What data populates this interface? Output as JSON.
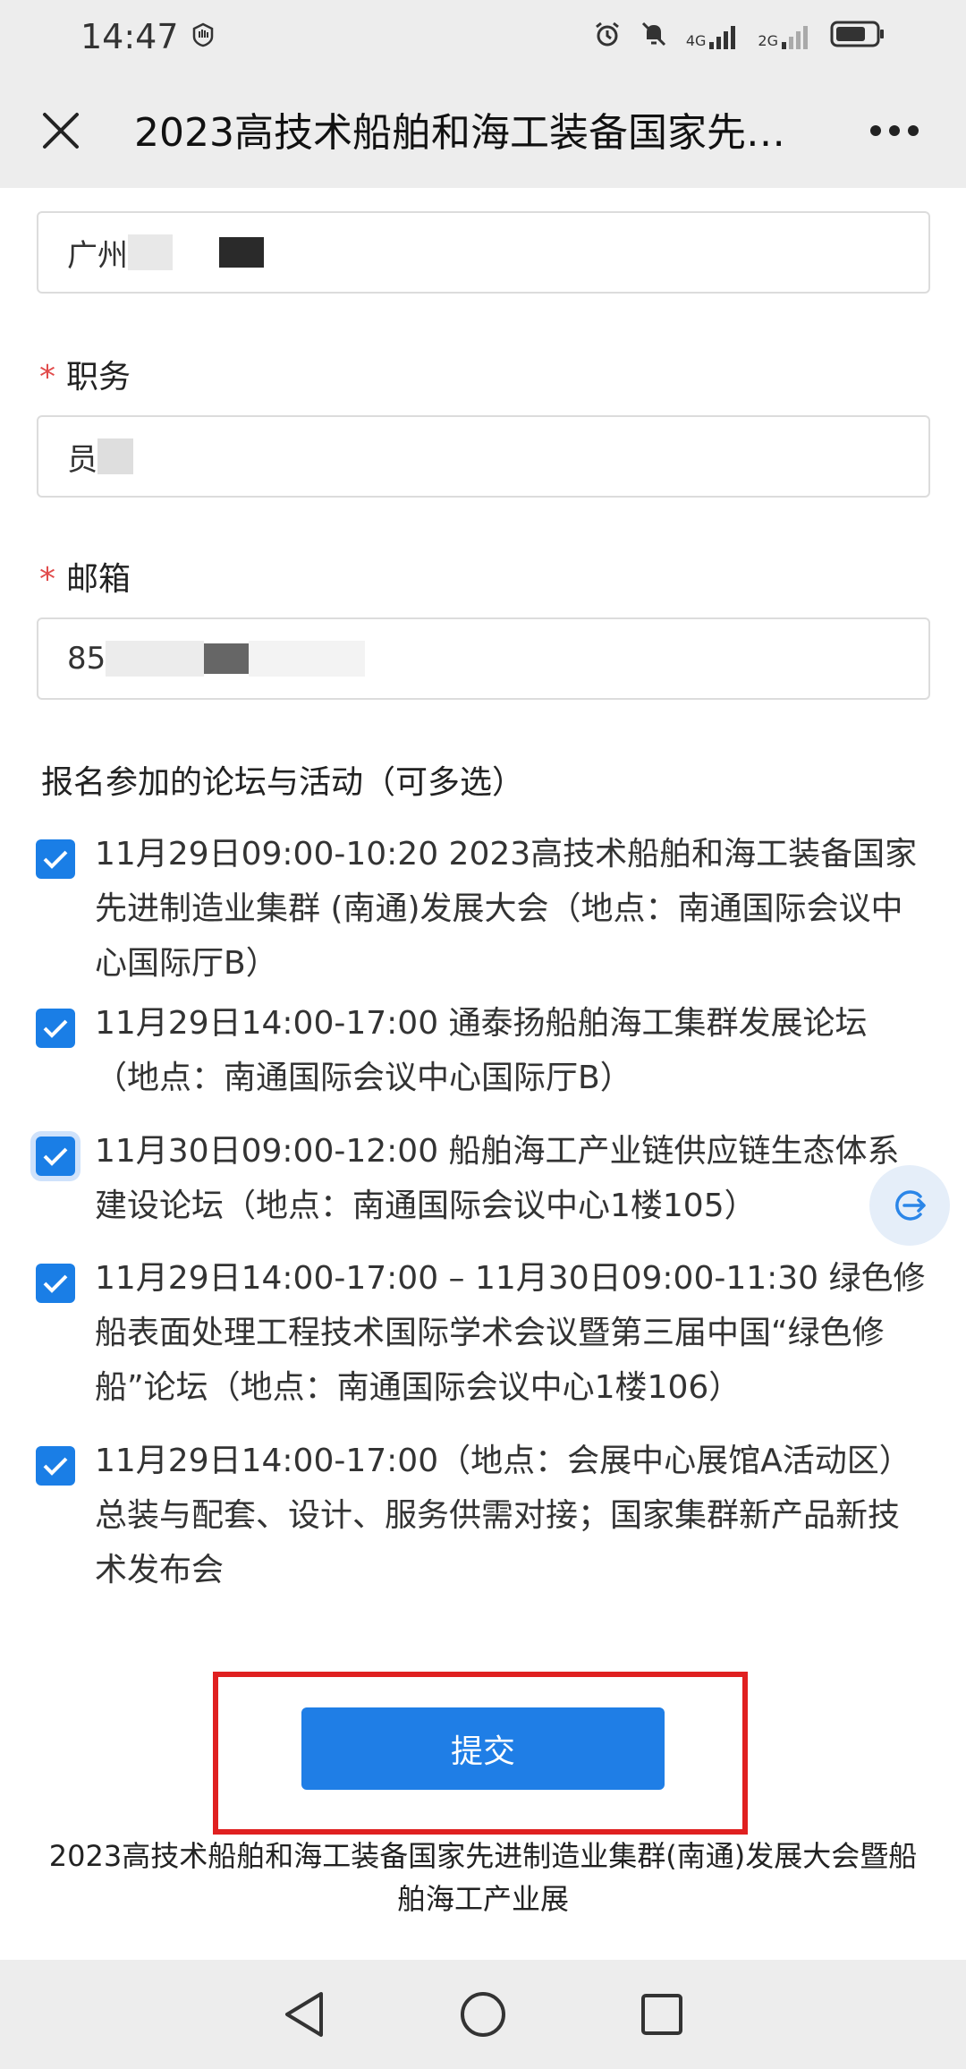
{
  "status_bar": {
    "time": "14:47",
    "network_1": "4G",
    "network_2": "2G"
  },
  "header": {
    "title": "2023高技术船舶和海工装备国家先…"
  },
  "form": {
    "company_value_visible": "广州",
    "position_label": "职务",
    "position_value_visible": "员",
    "email_label": "邮箱",
    "email_value_visible": "85",
    "required_mark": "*"
  },
  "activities": {
    "title": "报名参加的论坛与活动（可多选）",
    "options": [
      {
        "label": "11月29日09:00-10:20 2023高技术船舶和海工装备国家先进制造业集群 (南通)发展大会（地点：南通国际会议中心国际厅B）",
        "checked": true
      },
      {
        "label": "11月29日14:00-17:00 通泰扬船舶海工集群发展论坛（地点：南通国际会议中心国际厅B）",
        "checked": true
      },
      {
        "label": "11月30日09:00-12:00 船舶海工产业链供应链生态体系建设论坛（地点：南通国际会议中心1楼105）",
        "checked": true
      },
      {
        "label": "11月29日14:00-17:00 – 11月30日09:00-11:30 绿色修船表面处理工程技术国际学术会议暨第三届中国“绿色修船”论坛（地点：南通国际会议中心1楼106）",
        "checked": true
      },
      {
        "label": "11月29日14:00-17:00（地点：会展中心展馆A活动区） 总装与配套、设计、服务供需对接；国家集群新产品新技术发布会",
        "checked": true
      }
    ]
  },
  "submit": {
    "label": "提交"
  },
  "footer": {
    "text": "2023高技术船舶和海工装备国家先进制造业集群(南通)发展大会暨船舶海工产业展"
  },
  "colors": {
    "accent": "#1f7ee6",
    "highlight": "#e02020"
  }
}
